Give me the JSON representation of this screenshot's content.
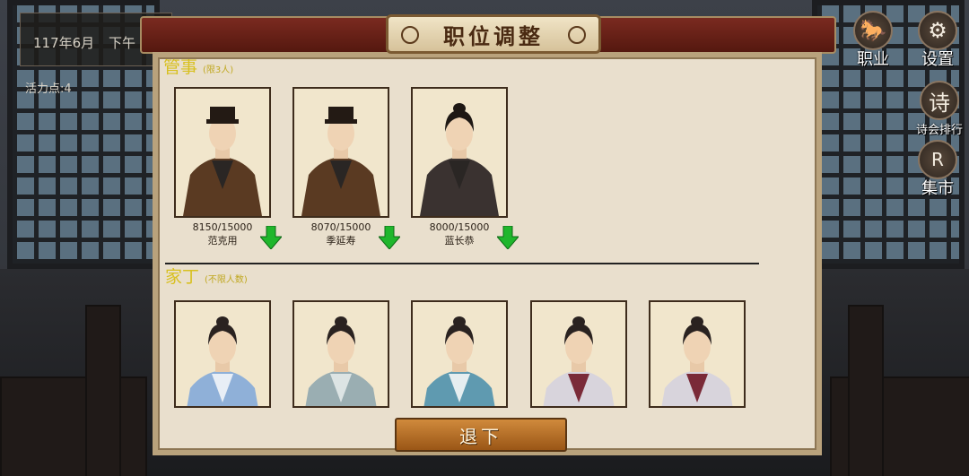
{
  "hud": {
    "date": "117年6月",
    "time_of_day": "下午",
    "vitality": "活力点:4"
  },
  "side_buttons": [
    {
      "label": "职业",
      "icon": "profession-icon",
      "glyph": "🐎"
    },
    {
      "label": "设置",
      "icon": "gear-icon",
      "glyph": "⚙"
    },
    {
      "label": "诗会排行",
      "icon": "poetry-icon",
      "glyph": "诗"
    },
    {
      "label": "集市",
      "icon": "market-icon",
      "glyph": "R"
    }
  ],
  "panel": {
    "title": "职位调整",
    "steward_section": {
      "title": "管事",
      "limit": "(限3人)"
    },
    "servant_section": {
      "title": "家丁",
      "limit": "(不限人数)"
    },
    "withdraw_label": "退下"
  },
  "stewards": [
    {
      "name": "范克用",
      "exp": "8150/15000",
      "robe": "#5a3a22",
      "hat": true
    },
    {
      "name": "季延寿",
      "exp": "8070/15000",
      "robe": "#5a3a22",
      "hat": true
    },
    {
      "name": "蓝长恭",
      "exp": "8000/15000",
      "robe": "#3a3230",
      "hat": false
    }
  ],
  "servants": [
    {
      "robe": "#8fb0d8",
      "inner": "#e8eef6"
    },
    {
      "robe": "#9aaeb2",
      "inner": "#dce4e4"
    },
    {
      "robe": "#5f9ab0",
      "inner": "#e6eef0"
    },
    {
      "robe": "#d8d4dc",
      "inner": "#7a2a38"
    },
    {
      "robe": "#d8d4dc",
      "inner": "#7a2a38"
    }
  ],
  "colors": {
    "accent_gold": "#d8c020",
    "arrow_green": "#1fb62c",
    "banner_red": "#6e2418"
  }
}
